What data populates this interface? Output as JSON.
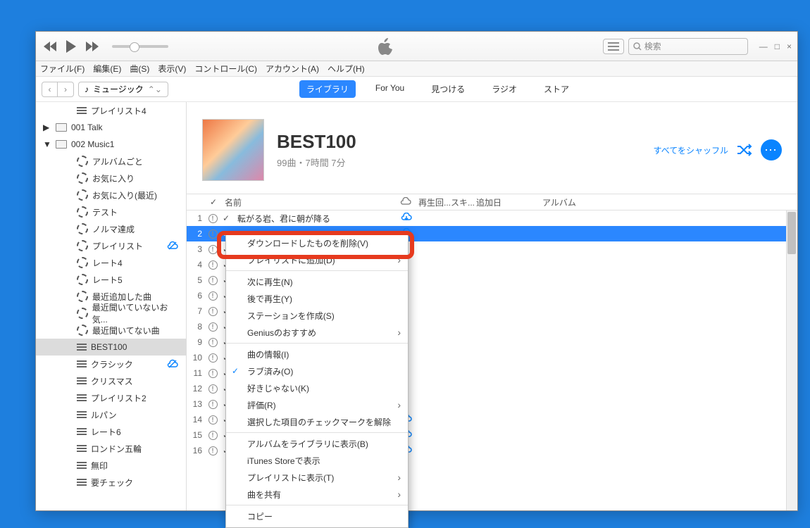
{
  "titlebar": {
    "search_placeholder": "検索",
    "min": "—",
    "max": "□",
    "close": "×"
  },
  "menu": [
    "ファイル(F)",
    "編集(E)",
    "曲(S)",
    "表示(V)",
    "コントロール(C)",
    "アカウント(A)",
    "ヘルプ(H)"
  ],
  "source": {
    "label": "ミュージック",
    "icon": "♪"
  },
  "tabs": [
    {
      "label": "ライブラリ",
      "active": true
    },
    {
      "label": "For You",
      "active": false
    },
    {
      "label": "見つける",
      "active": false
    },
    {
      "label": "ラジオ",
      "active": false
    },
    {
      "label": "ストア",
      "active": false
    }
  ],
  "sidebar": [
    {
      "type": "playlist-sub",
      "label": "プレイリスト4"
    },
    {
      "type": "folder",
      "label": "001 Talk",
      "expand": "▶"
    },
    {
      "type": "folder",
      "label": "002 Music1",
      "expand": "▼"
    },
    {
      "type": "smart",
      "label": "アルバムごと"
    },
    {
      "type": "smart",
      "label": "お気に入り"
    },
    {
      "type": "smart",
      "label": "お気に入り(最近)"
    },
    {
      "type": "smart",
      "label": "テスト"
    },
    {
      "type": "smart",
      "label": "ノルマ達成"
    },
    {
      "type": "smart",
      "label": "プレイリスト",
      "cloud": true
    },
    {
      "type": "smart",
      "label": "レート4"
    },
    {
      "type": "smart",
      "label": "レート5"
    },
    {
      "type": "smart",
      "label": "最近追加した曲"
    },
    {
      "type": "smart",
      "label": "最近聞いていないお気..."
    },
    {
      "type": "smart",
      "label": "最近聞いてない曲"
    },
    {
      "type": "playlist",
      "label": "BEST100",
      "selected": true
    },
    {
      "type": "playlist",
      "label": "クラシック",
      "cloud": true
    },
    {
      "type": "playlist",
      "label": "クリスマス"
    },
    {
      "type": "playlist",
      "label": "プレイリスト2"
    },
    {
      "type": "playlist",
      "label": "ルパン"
    },
    {
      "type": "playlist",
      "label": "レート6"
    },
    {
      "type": "playlist",
      "label": "ロンドン五輪"
    },
    {
      "type": "playlist",
      "label": "無印"
    },
    {
      "type": "playlist",
      "label": "要チェック"
    }
  ],
  "playlist": {
    "title": "BEST100",
    "subtitle": "99曲・7時間 7分",
    "shuffle": "すべてをシャッフル"
  },
  "columns": {
    "name": "名前",
    "plays": "再生回...",
    "skip": "スキ...",
    "added": "追加日",
    "album": "アルバム"
  },
  "rows": [
    {
      "n": "1",
      "name": "転がる岩、君に朝が降る",
      "cloud": true
    },
    {
      "n": "2",
      "name": "",
      "sel": true,
      "cloud": true
    },
    {
      "n": "3",
      "name": ""
    },
    {
      "n": "4",
      "name": ""
    },
    {
      "n": "5",
      "name": ""
    },
    {
      "n": "6",
      "name": ""
    },
    {
      "n": "7",
      "name": ""
    },
    {
      "n": "8",
      "name": ""
    },
    {
      "n": "9",
      "name": ""
    },
    {
      "n": "10",
      "name": ""
    },
    {
      "n": "11",
      "name": ""
    },
    {
      "n": "12",
      "name": ""
    },
    {
      "n": "13",
      "name": ""
    },
    {
      "n": "14",
      "name": "",
      "cloud": true
    },
    {
      "n": "15",
      "name": "",
      "cloud": true
    },
    {
      "n": "16",
      "name": "",
      "cloud": true
    }
  ],
  "context": [
    {
      "label": "ダウンロードしたものを削除(V)",
      "highlight": true
    },
    {
      "label": "プレイリストに追加(D)",
      "sub": true,
      "hidden": true
    },
    {
      "sep": true
    },
    {
      "label": "次に再生(N)"
    },
    {
      "label": "後で再生(Y)"
    },
    {
      "label": "ステーションを作成(S)"
    },
    {
      "label": "Geniusのおすすめ",
      "sub": true
    },
    {
      "sep": true
    },
    {
      "label": "曲の情報(I)"
    },
    {
      "label": "ラブ済み(O)",
      "checked": true
    },
    {
      "label": "好きじゃない(K)"
    },
    {
      "label": "評価(R)",
      "sub": true
    },
    {
      "label": "選択した項目のチェックマークを解除"
    },
    {
      "sep": true
    },
    {
      "label": "アルバムをライブラリに表示(B)"
    },
    {
      "label": "iTunes Storeで表示"
    },
    {
      "label": "プレイリストに表示(T)",
      "sub": true
    },
    {
      "label": "曲を共有",
      "sub": true
    },
    {
      "sep": true
    },
    {
      "label": "コピー"
    }
  ]
}
